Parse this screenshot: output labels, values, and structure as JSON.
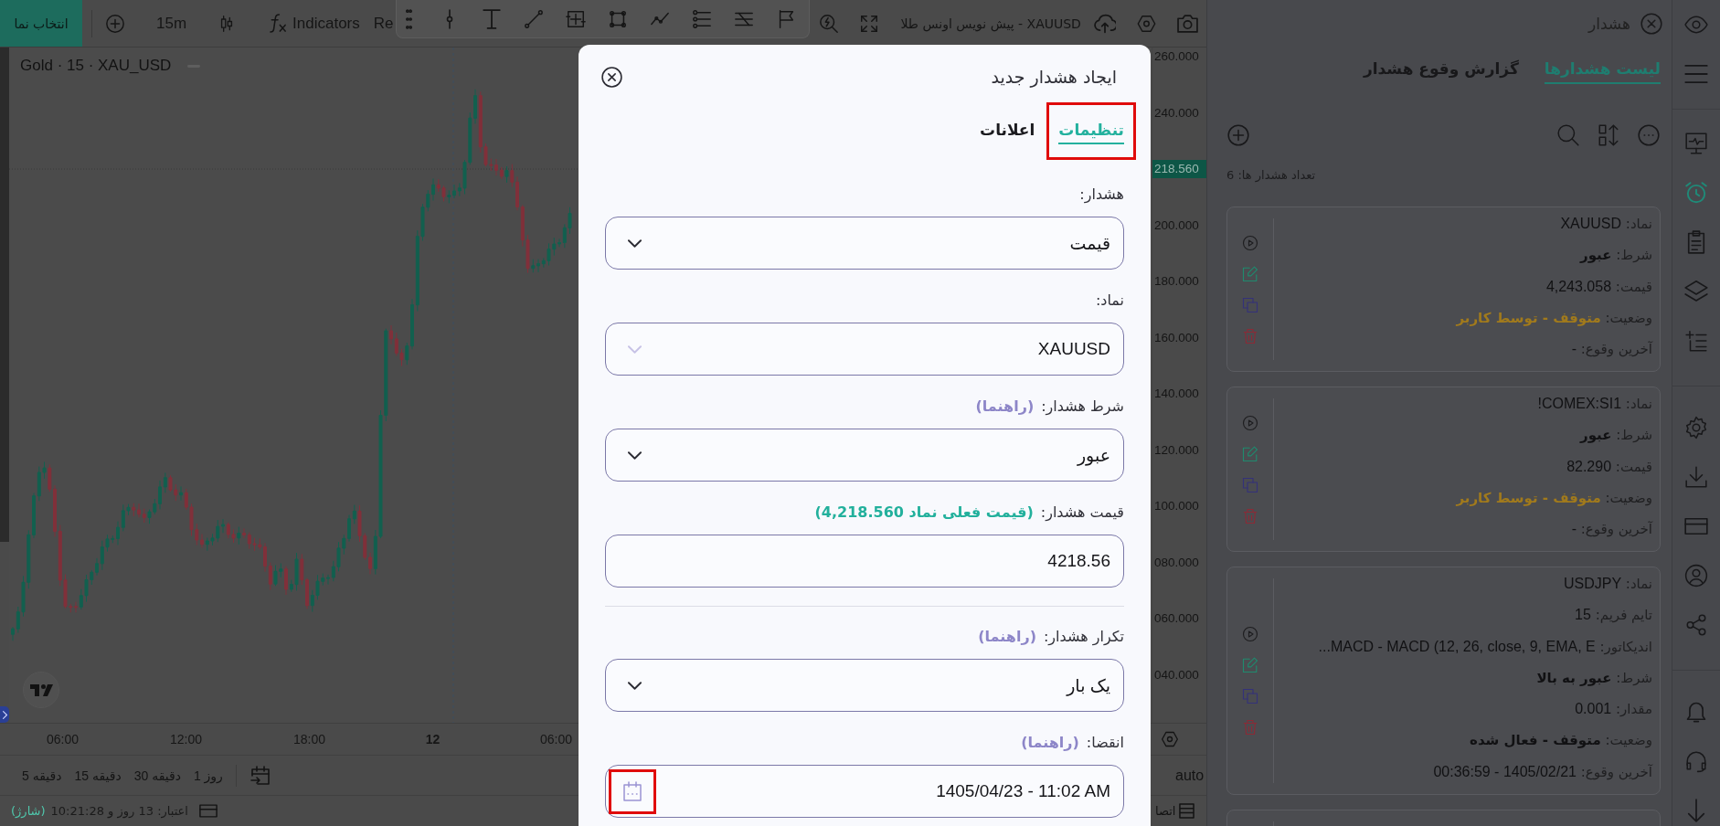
{
  "top_bar": {
    "symbol_button": "انتخاب نما",
    "interval": "15m",
    "indicators_button": "Indicators",
    "cut_button": "Re",
    "chart_title": "XAUUSD - پیش نویس اونس طلا"
  },
  "chart": {
    "legend": "Gold · 15 · XAU_USD",
    "price_labels": [
      {
        "kind": "tick",
        "text": "260.000"
      },
      {
        "kind": "tick",
        "text": "240.000"
      },
      {
        "kind": "last_price",
        "text": "218.560"
      },
      {
        "kind": "tick",
        "text": "200.000"
      },
      {
        "kind": "tick",
        "text": "180.000"
      },
      {
        "kind": "tick",
        "text": "160.000"
      },
      {
        "kind": "tick",
        "text": "140.000"
      },
      {
        "kind": "tick",
        "text": "120.000"
      },
      {
        "kind": "tick",
        "text": "100.000"
      },
      {
        "kind": "tick",
        "text": "080.000"
      },
      {
        "kind": "tick",
        "text": "060.000"
      },
      {
        "kind": "tick",
        "text": "040.000"
      }
    ],
    "time_labels": [
      {
        "kind": "time",
        "text": "06:00"
      },
      {
        "kind": "day",
        "text": "12"
      },
      {
        "kind": "time",
        "text": "18:00"
      },
      {
        "kind": "time",
        "text": "12:00"
      },
      {
        "kind": "time",
        "text": "06:00"
      }
    ]
  },
  "range_bar": {
    "ranges": [
      "1 روز",
      "30 دقیقه",
      "15 دقیقه",
      "5 دقیقه"
    ],
    "scale_mode": "auto"
  },
  "status_bar": {
    "subscription": "اعتبار: 13 روز و 10:21:28",
    "recharge_link": "(شارژ)",
    "connection": "اتصا"
  },
  "dialog": {
    "title": "ایجاد هشدار جدید",
    "tabs": [
      {
        "label": "تنظیمات",
        "selected": true,
        "highlighted": true
      },
      {
        "label": "اعلانات",
        "selected": false,
        "highlighted": false
      }
    ],
    "sections": [
      {
        "fields": [
          {
            "kind": "select",
            "label": "هشدار:",
            "value": "قیمت",
            "disabled": false
          },
          {
            "kind": "select",
            "label": "نماد:",
            "value": "XAUUSD",
            "disabled": true
          },
          {
            "kind": "select",
            "label": "شرط هشدار:",
            "hint": "(راهنما)",
            "value": "عبور",
            "disabled": false
          },
          {
            "kind": "input",
            "label": "قیمت هشدار:",
            "note": "(قیمت فعلی نماد 4,218.560)",
            "value": "4218.56"
          }
        ]
      },
      {
        "fields": [
          {
            "kind": "select",
            "label": "تکرار هشدار:",
            "hint": "(راهنما)",
            "value": "یک بار",
            "disabled": false
          },
          {
            "kind": "date",
            "label": "انقضا:",
            "hint": "(راهنما)",
            "value": "1405/04/23 - 11:02 AM",
            "icon_highlighted": true
          }
        ]
      }
    ]
  },
  "alerts_panel": {
    "title": "هشدار",
    "tabs": [
      {
        "label": "لیست هشدارها",
        "selected": true
      },
      {
        "label": "گزارش وقوع هشدار",
        "selected": false
      }
    ],
    "count": "تعداد هشدار ها: 6",
    "alerts": [
      {
        "lines": [
          {
            "kind": "text",
            "label": "نماد:",
            "value": "XAUUSD"
          },
          {
            "kind": "emphasis",
            "label": "شرط:",
            "value": "عبور"
          },
          {
            "kind": "text",
            "label": "قیمت:",
            "value": "4,243.058"
          },
          {
            "kind": "status",
            "label": "وضعیت:",
            "value": "متوقف - توسط کاربر",
            "color": "#a17a1c"
          },
          {
            "kind": "text",
            "label": "آخرین وقوع:",
            "value": "-"
          }
        ]
      },
      {
        "lines": [
          {
            "kind": "text",
            "label": "نماد:",
            "value": "COMEX:SI1!"
          },
          {
            "kind": "emphasis",
            "label": "شرط:",
            "value": "عبور"
          },
          {
            "kind": "text",
            "label": "قیمت:",
            "value": "82.290"
          },
          {
            "kind": "status",
            "label": "وضعیت:",
            "value": "متوقف - توسط کاربر",
            "color": "#a17a1c"
          },
          {
            "kind": "text",
            "label": "آخرین وقوع:",
            "value": "-"
          }
        ]
      },
      {
        "lines": [
          {
            "kind": "text",
            "label": "نماد:",
            "value": "USDJPY"
          },
          {
            "kind": "text",
            "label": "تایم فریم:",
            "value": "15"
          },
          {
            "kind": "text",
            "label": "اندیکاتور:",
            "value": "MACD - MACD (12, 26, close, 9, EMA, E..."
          },
          {
            "kind": "emphasis",
            "label": "شرط:",
            "value": "عبور به بالا"
          },
          {
            "kind": "text",
            "label": "مقدار:",
            "value": "0.001"
          },
          {
            "kind": "emphasis",
            "label": "وضعیت:",
            "value": "متوقف - فعال شده"
          },
          {
            "kind": "text",
            "label": "آخرین وقوع:",
            "value": "1405/02/21 - 00:36:59"
          }
        ]
      }
    ],
    "more_below": true
  },
  "icon_rail": {
    "groups": [
      {
        "items": [
          {
            "selected": false
          },
          {
            "selected": false
          }
        ]
      },
      {
        "items": [
          {
            "selected": false
          },
          {
            "selected": true
          },
          {
            "selected": false
          },
          {
            "selected": false
          },
          {
            "selected": false
          }
        ]
      },
      {
        "items": [
          {
            "selected": false
          },
          {
            "selected": false
          },
          {
            "selected": false
          },
          {
            "selected": false
          },
          {
            "selected": false
          }
        ]
      },
      {
        "items": [
          {
            "selected": false
          },
          {
            "selected": false
          },
          {
            "selected": false
          }
        ]
      }
    ]
  }
}
